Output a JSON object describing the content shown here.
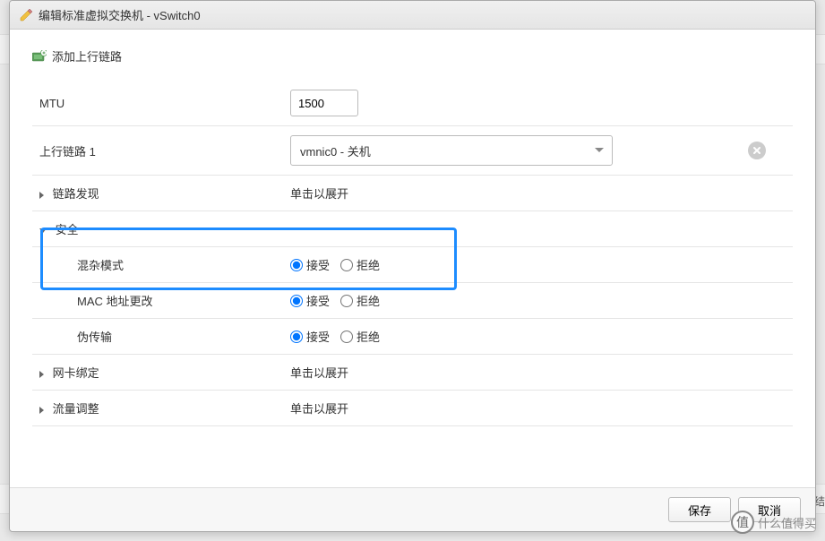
{
  "dialog": {
    "title": "编辑标准虚拟交换机 - vSwitch0"
  },
  "topAction": {
    "label": "添加上行链路"
  },
  "rows": {
    "mtu": {
      "label": "MTU",
      "value": "1500"
    },
    "uplink": {
      "label": "上行链路 1",
      "selected": "vmnic0 - 关机"
    },
    "linkDiscovery": {
      "label": "链路发现",
      "expandText": "单击以展开"
    },
    "security": {
      "label": "安全"
    },
    "promiscuous": {
      "label": "混杂模式",
      "accept": "接受",
      "reject": "拒绝"
    },
    "macChanges": {
      "label": "MAC 地址更改",
      "accept": "接受",
      "reject": "拒绝"
    },
    "forged": {
      "label": "伪传输",
      "accept": "接受",
      "reject": "拒绝"
    },
    "teaming": {
      "label": "网卡绑定",
      "expandText": "单击以展开"
    },
    "shaping": {
      "label": "流量调整",
      "expandText": "单击以展开"
    }
  },
  "footer": {
    "save": "保存",
    "cancel": "取消"
  },
  "watermark": {
    "icon": "值",
    "text": "什么值得买"
  },
  "sideText": "结"
}
